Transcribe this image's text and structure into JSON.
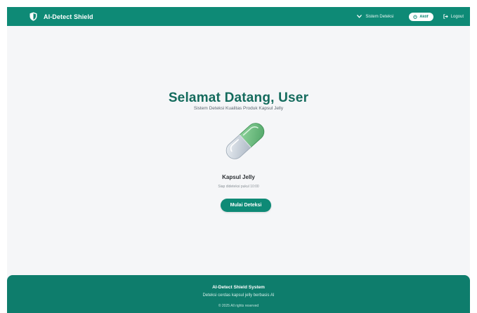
{
  "app": {
    "brand_name": "AI-Detect Shield"
  },
  "navbar": {
    "menu_label": "Sistem Deteksi",
    "status_label": "Aktif",
    "logout_label": "Logout"
  },
  "main": {
    "welcome_title": "Selamat Datang, User",
    "subtitle": "Sistem Deteksi Kualitas Produk Kapsul Jelly",
    "product_name": "Kapsul Jelly",
    "product_status": "Siap dideteksi pukul 10:00",
    "start_button_label": "Mulai Deteksi"
  },
  "footer": {
    "title": "AI-Detect Shield System",
    "tagline": "Deteksi cerdas kapsul jelly berbasis AI",
    "copyright": "© 2025 All rights reserved"
  },
  "icons": {
    "brand": "shield-icon",
    "menu": "chevron-down-icon",
    "status": "power-icon",
    "logout": "logout-icon",
    "product": "capsule-icon"
  },
  "colors": {
    "primary": "#0e8a76",
    "title": "#146b5d",
    "footer": "#0e7d6c",
    "capsule_green": "#5fb878",
    "capsule_gray": "#c9d1da",
    "background": "#f5f6f8"
  }
}
